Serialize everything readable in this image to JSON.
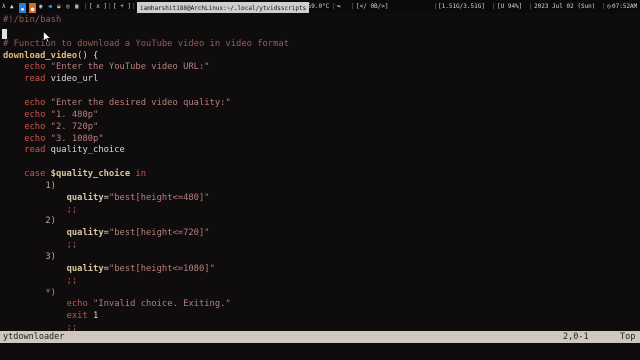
{
  "topbar": {
    "tags": [
      "x",
      "+"
    ],
    "window_title": "iamharshit188@ArchLinux:~/.local/ytvidsscripts",
    "temperature": "+59.0°C",
    "volume": "[</  0B/>]",
    "memory": "[1.51G/3.51G]",
    "battery": "[U 94%]",
    "date": "2023 Jul 02 (Sun)",
    "time": "07:52AM",
    "colors": {
      "accent": "#2b7fd6",
      "title_bg": "#cfcfcf"
    }
  },
  "editor": {
    "lines": [
      [
        {
          "c": "k-shebang",
          "t": "#!/bin/bash"
        }
      ],
      [],
      [
        {
          "c": "k-comment",
          "t": "# Function to download a YouTube video in video format"
        }
      ],
      [
        {
          "c": "k-fn",
          "t": "download_video"
        },
        {
          "c": "k-plain",
          "t": "() {"
        }
      ],
      [
        {
          "c": "k-plain",
          "t": "    "
        },
        {
          "c": "k-kw",
          "t": "echo"
        },
        {
          "c": "k-str",
          "t": " \"Enter the YouTube video URL:\""
        }
      ],
      [
        {
          "c": "k-plain",
          "t": "    "
        },
        {
          "c": "k-kw",
          "t": "read"
        },
        {
          "c": "k-plain",
          "t": " video_url"
        }
      ],
      [],
      [
        {
          "c": "k-plain",
          "t": "    "
        },
        {
          "c": "k-kw",
          "t": "echo"
        },
        {
          "c": "k-str",
          "t": " \"Enter the desired video quality:\""
        }
      ],
      [
        {
          "c": "k-plain",
          "t": "    "
        },
        {
          "c": "k-kw",
          "t": "echo"
        },
        {
          "c": "k-str",
          "t": " \"1. 480p\""
        }
      ],
      [
        {
          "c": "k-plain",
          "t": "    "
        },
        {
          "c": "k-kw",
          "t": "echo"
        },
        {
          "c": "k-str",
          "t": " \"2. 720p\""
        }
      ],
      [
        {
          "c": "k-plain",
          "t": "    "
        },
        {
          "c": "k-kw",
          "t": "echo"
        },
        {
          "c": "k-str",
          "t": " \"3. 1080p\""
        }
      ],
      [
        {
          "c": "k-plain",
          "t": "    "
        },
        {
          "c": "k-kw",
          "t": "read"
        },
        {
          "c": "k-plain",
          "t": " quality_choice"
        }
      ],
      [],
      [
        {
          "c": "k-plain",
          "t": "    "
        },
        {
          "c": "k-kw",
          "t": "case"
        },
        {
          "c": "k-var",
          "t": " $quality_choice"
        },
        {
          "c": "k-kw",
          "t": " in"
        }
      ],
      [
        {
          "c": "k-plain",
          "t": "        "
        },
        {
          "c": "k-num",
          "t": "1)"
        }
      ],
      [
        {
          "c": "k-plain",
          "t": "            "
        },
        {
          "c": "k-var",
          "t": "quality"
        },
        {
          "c": "k-plain",
          "t": "="
        },
        {
          "c": "k-str",
          "t": "\"best[height<=480]\""
        }
      ],
      [
        {
          "c": "k-plain",
          "t": "            "
        },
        {
          "c": "k-kw",
          "t": ";;"
        }
      ],
      [
        {
          "c": "k-plain",
          "t": "        "
        },
        {
          "c": "k-num",
          "t": "2)"
        }
      ],
      [
        {
          "c": "k-plain",
          "t": "            "
        },
        {
          "c": "k-var",
          "t": "quality"
        },
        {
          "c": "k-plain",
          "t": "="
        },
        {
          "c": "k-str",
          "t": "\"best[height<=720]\""
        }
      ],
      [
        {
          "c": "k-plain",
          "t": "            "
        },
        {
          "c": "k-kw",
          "t": ";;"
        }
      ],
      [
        {
          "c": "k-plain",
          "t": "        "
        },
        {
          "c": "k-num",
          "t": "3)"
        }
      ],
      [
        {
          "c": "k-plain",
          "t": "            "
        },
        {
          "c": "k-var",
          "t": "quality"
        },
        {
          "c": "k-plain",
          "t": "="
        },
        {
          "c": "k-str",
          "t": "\"best[height<=1080]\""
        }
      ],
      [
        {
          "c": "k-plain",
          "t": "            "
        },
        {
          "c": "k-kw",
          "t": ";;"
        }
      ],
      [
        {
          "c": "k-plain",
          "t": "        "
        },
        {
          "c": "k-str",
          "t": "*)"
        }
      ],
      [
        {
          "c": "k-plain",
          "t": "            "
        },
        {
          "c": "k-kw",
          "t": "echo"
        },
        {
          "c": "k-str",
          "t": " \"Invalid choice. Exiting.\""
        }
      ],
      [
        {
          "c": "k-plain",
          "t": "            "
        },
        {
          "c": "k-kw",
          "t": "exit"
        },
        {
          "c": "k-plain",
          "t": " 1"
        }
      ],
      [
        {
          "c": "k-plain",
          "t": "            "
        },
        {
          "c": "k-kw",
          "t": ";;"
        }
      ]
    ]
  },
  "statusbar": {
    "filename": "ytdownloader",
    "position": "2,0-1",
    "scroll": "Top"
  }
}
